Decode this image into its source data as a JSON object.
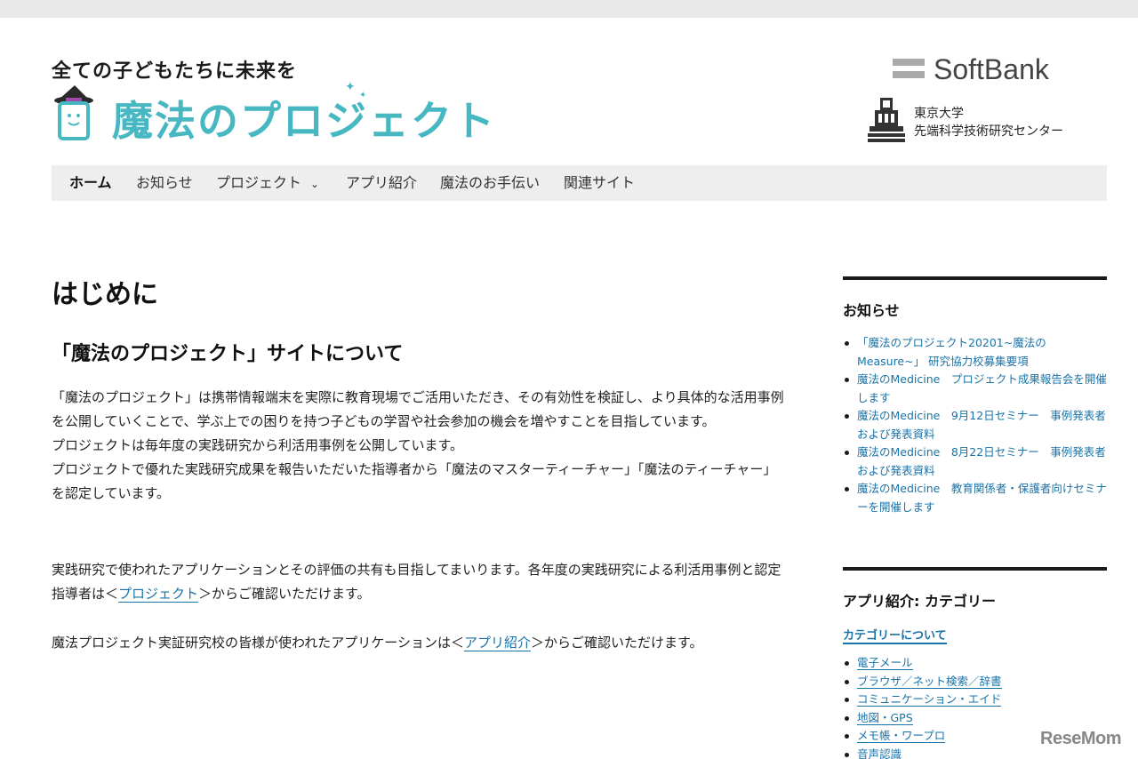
{
  "header": {
    "tagline": "全ての子どもたちに未来を",
    "logo_text": "魔法のプロジェクト",
    "partner1": "SoftBank",
    "partner2_line1": "東京大学",
    "partner2_line2": "先端科学技術研究センター"
  },
  "nav": {
    "items": [
      "ホーム",
      "お知らせ",
      "プロジェクト",
      "アプリ紹介",
      "魔法のお手伝い",
      "関連サイト"
    ]
  },
  "main": {
    "title": "はじめに",
    "section_title": "「魔法のプロジェクト」サイトについて",
    "p1": "「魔法のプロジェクト」は携帯情報端末を実際に教育現場でご活用いただき、その有効性を検証し、より具体的な活用事例を公開していくことで、学ぶ上での困りを持つ子どもの学習や社会参加の機会を増やすことを目指しています。",
    "p2": "プロジェクトは毎年度の実践研究から利活用事例を公開しています。",
    "p3": "プロジェクトで優れた実践研究成果を報告いただいた指導者から「魔法のマスターティーチャー」「魔法のティーチャー」を認定しています。",
    "p4_before": "実践研究で使われたアプリケーションとその評価の共有も目指してまいります。各年度の実践研究による利活用事例と認定指導者は＜",
    "p4_link": "プロジェクト",
    "p4_after": "＞からご確認いただけます。",
    "p5_before": "魔法プロジェクト実証研究校の皆様が使われたアプリケーションは＜",
    "p5_link": "アプリ紹介",
    "p5_after": "＞からご確認いただけます。"
  },
  "sidebar": {
    "news_heading": "お知らせ",
    "news_items": [
      "「魔法のプロジェクト20201~魔法のMeasure~」 研究協力校募集要項",
      "魔法のMedicine　プロジェクト成果報告会を開催します",
      "魔法のMedicine　9月12日セミナー　事例発表者および発表資料",
      "魔法のMedicine　8月22日セミナー　事例発表者および発表資料",
      "魔法のMedicine　教育関係者・保護者向けセミナーを開催します"
    ],
    "apps_heading": "アプリ紹介: カテゴリー",
    "category_link": "カテゴリーについて",
    "categories": [
      "電子メール",
      "ブラウザ／ネット検索／辞書",
      "コミュニケーション・エイド",
      "地図・GPS",
      "メモ帳・ワープロ",
      "音声認識"
    ]
  },
  "watermark": "ReseMom",
  "colors": {
    "accent": "#47b8c2",
    "link": "#1a73a8"
  }
}
